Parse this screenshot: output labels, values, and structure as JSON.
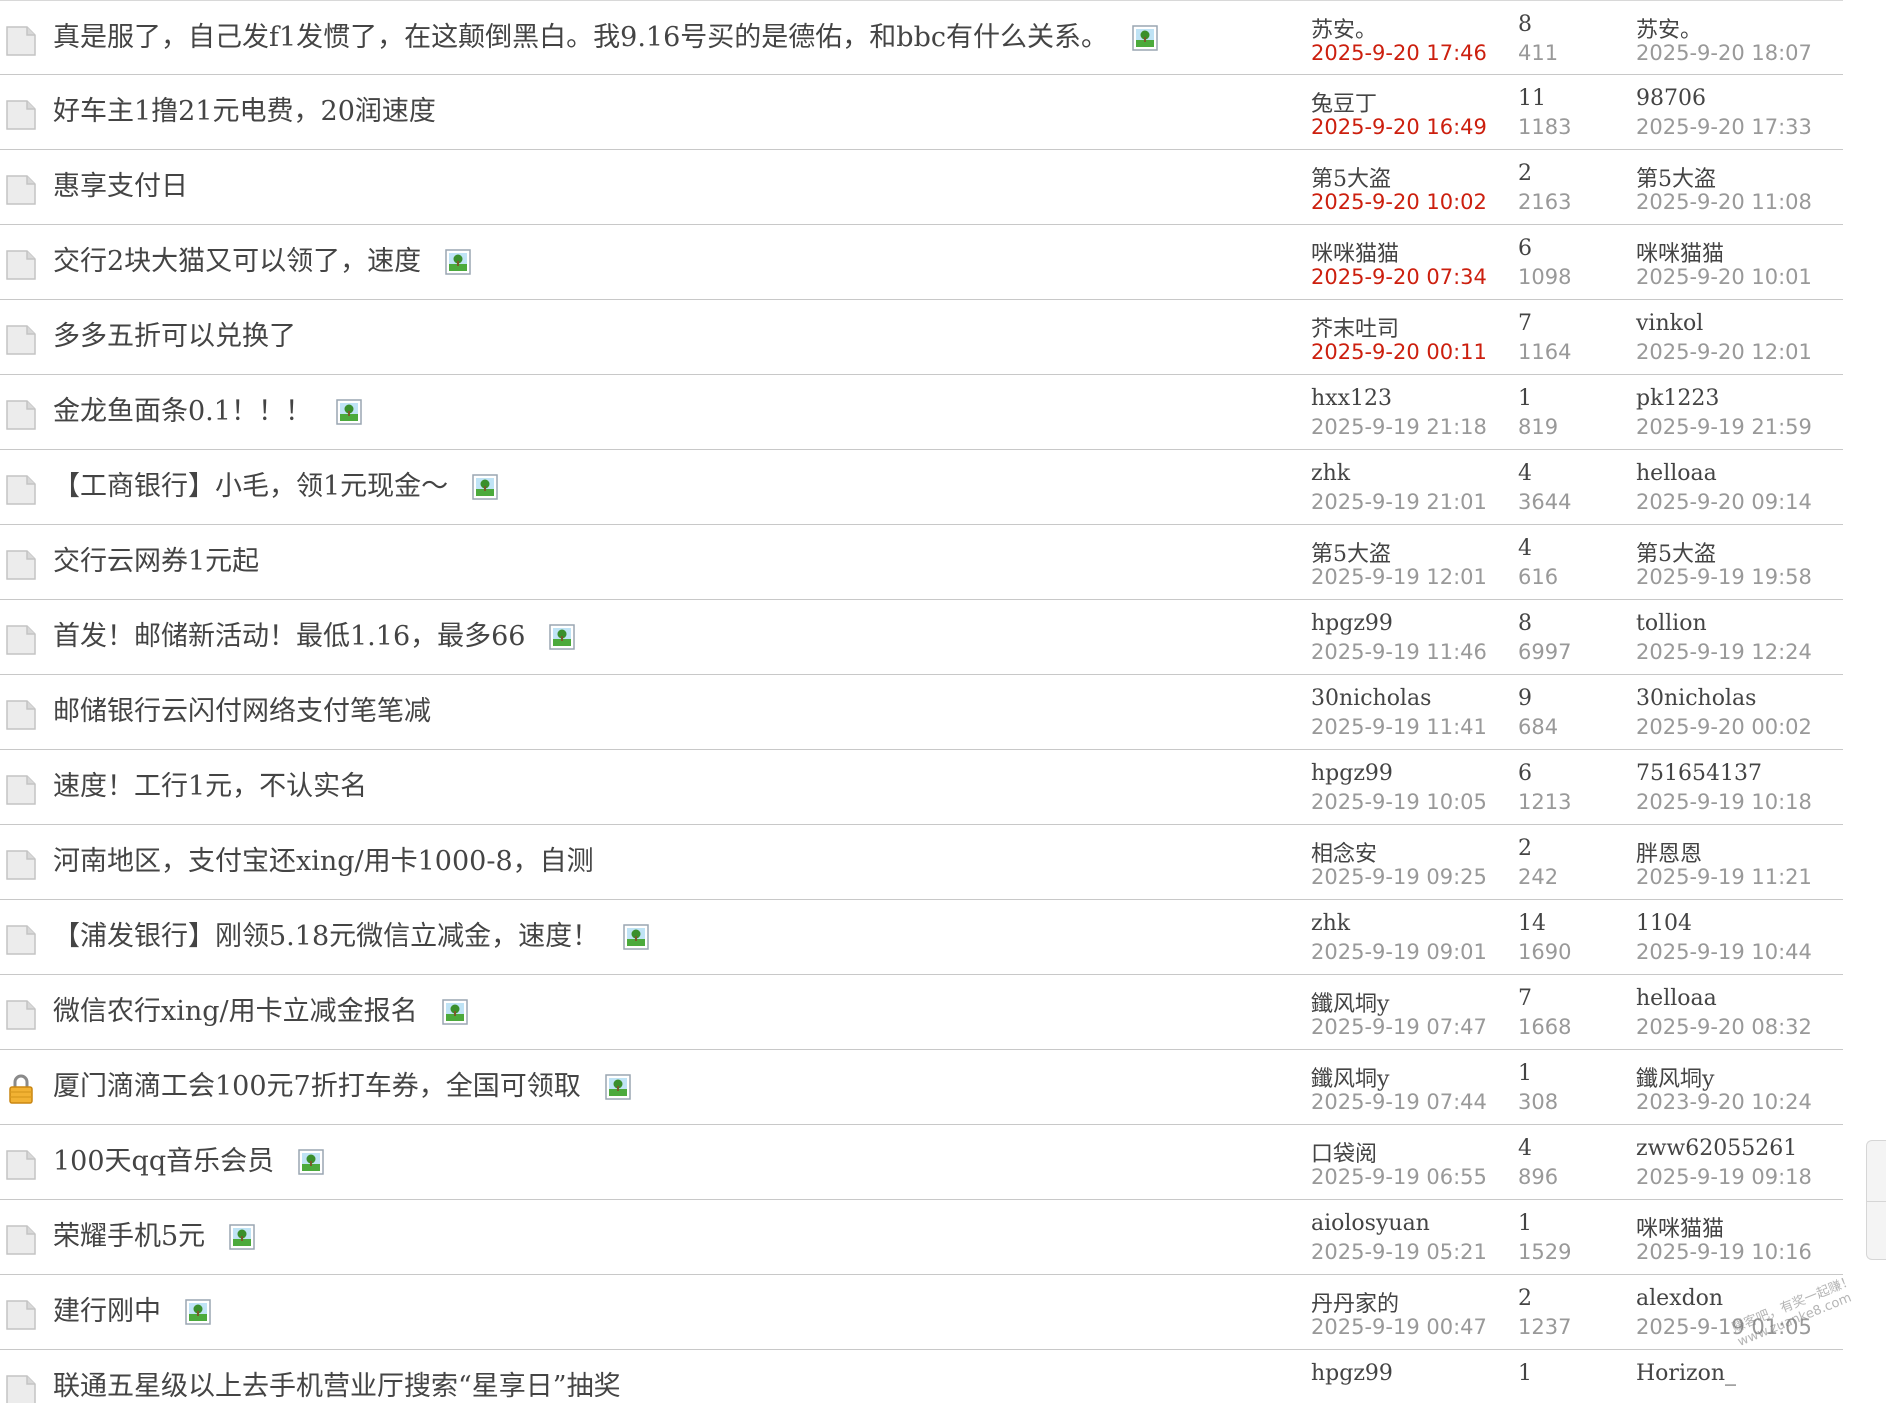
{
  "colors": {
    "new_time": "#cc1f0e",
    "muted": "#999999",
    "text": "#444444",
    "divider": "#c8c8c8"
  },
  "threads": [
    {
      "subject": "真是服了，自己发f1发惯了，在这颠倒黑白。我9.16号买的是德佑，和bbc有什么关系。",
      "icon": "folder-icon",
      "has_image": true,
      "author": "苏安。",
      "post_time": "2025-9-20 17:46",
      "post_time_new": true,
      "replies": "8",
      "views": "411",
      "last_user": "苏安。",
      "last_time": "2025-9-20 18:07"
    },
    {
      "subject": "好车主1撸21元电费，20润速度",
      "icon": "folder-icon",
      "has_image": false,
      "author": "兔豆丁",
      "post_time": "2025-9-20 16:49",
      "post_time_new": true,
      "replies": "11",
      "views": "1183",
      "last_user": "98706",
      "last_time": "2025-9-20 17:33"
    },
    {
      "subject": "惠享支付日",
      "icon": "folder-icon",
      "has_image": false,
      "author": "第5大盗",
      "post_time": "2025-9-20 10:02",
      "post_time_new": true,
      "replies": "2",
      "views": "2163",
      "last_user": "第5大盗",
      "last_time": "2025-9-20 11:08"
    },
    {
      "subject": "交行2块大猫又可以领了，速度",
      "icon": "folder-icon",
      "has_image": true,
      "author": "咪咪猫猫",
      "post_time": "2025-9-20 07:34",
      "post_time_new": true,
      "replies": "6",
      "views": "1098",
      "last_user": "咪咪猫猫",
      "last_time": "2025-9-20 10:01"
    },
    {
      "subject": "多多五折可以兑换了",
      "icon": "folder-icon",
      "has_image": false,
      "author": "芥末吐司",
      "post_time": "2025-9-20 00:11",
      "post_time_new": true,
      "replies": "7",
      "views": "1164",
      "last_user": "vinkol",
      "last_time": "2025-9-20 12:01"
    },
    {
      "subject": "金龙鱼面条0.1！！！",
      "icon": "folder-icon",
      "has_image": true,
      "author": "hxx123",
      "post_time": "2025-9-19 21:18",
      "post_time_new": false,
      "replies": "1",
      "views": "819",
      "last_user": "pk1223",
      "last_time": "2025-9-19 21:59"
    },
    {
      "subject": "【工商银行】小毛，领1元现金～",
      "icon": "folder-icon",
      "has_image": true,
      "author": "zhk",
      "post_time": "2025-9-19 21:01",
      "post_time_new": false,
      "replies": "4",
      "views": "3644",
      "last_user": "helloaa",
      "last_time": "2025-9-20 09:14"
    },
    {
      "subject": "交行云网券1元起",
      "icon": "folder-icon",
      "has_image": false,
      "author": "第5大盗",
      "post_time": "2025-9-19 12:01",
      "post_time_new": false,
      "replies": "4",
      "views": "616",
      "last_user": "第5大盗",
      "last_time": "2025-9-19 19:58"
    },
    {
      "subject": "首发！邮储新活动！最低1.16，最多66",
      "icon": "folder-icon",
      "has_image": true,
      "author": "hpgz99",
      "post_time": "2025-9-19 11:46",
      "post_time_new": false,
      "replies": "8",
      "views": "6997",
      "last_user": "tollion",
      "last_time": "2025-9-19 12:24"
    },
    {
      "subject": "邮储银行云闪付网络支付笔笔减",
      "icon": "folder-icon",
      "has_image": false,
      "author": "30nicholas",
      "post_time": "2025-9-19 11:41",
      "post_time_new": false,
      "replies": "9",
      "views": "684",
      "last_user": "30nicholas",
      "last_time": "2025-9-20 00:02"
    },
    {
      "subject": "速度！工行1元，不认实名",
      "icon": "folder-icon",
      "has_image": false,
      "author": "hpgz99",
      "post_time": "2025-9-19 10:05",
      "post_time_new": false,
      "replies": "6",
      "views": "1213",
      "last_user": "751654137",
      "last_time": "2025-9-19 10:18"
    },
    {
      "subject": "河南地区，支付宝还xing/用卡1000-8，自测",
      "icon": "folder-icon",
      "has_image": false,
      "author": "相念安",
      "post_time": "2025-9-19 09:25",
      "post_time_new": false,
      "replies": "2",
      "views": "242",
      "last_user": "胖恩恩",
      "last_time": "2025-9-19 11:21"
    },
    {
      "subject": "【浦发银行】刚领5.18元微信立减金，速度！",
      "icon": "folder-icon",
      "has_image": true,
      "author": "zhk",
      "post_time": "2025-9-19 09:01",
      "post_time_new": false,
      "replies": "14",
      "views": "1690",
      "last_user": "1104",
      "last_time": "2025-9-19 10:44"
    },
    {
      "subject": "微信农行xing/用卡立减金报名",
      "icon": "folder-icon",
      "has_image": true,
      "author": "鑯风垌y",
      "post_time": "2025-9-19 07:47",
      "post_time_new": false,
      "replies": "7",
      "views": "1668",
      "last_user": "helloaa",
      "last_time": "2025-9-20 08:32"
    },
    {
      "subject": "厦门滴滴工会100元7折打车券，全国可领取",
      "icon": "lock-icon",
      "has_image": true,
      "author": "鑯风垌y",
      "post_time": "2025-9-19 07:44",
      "post_time_new": false,
      "replies": "1",
      "views": "308",
      "last_user": "鑯风垌y",
      "last_time": "2023-9-20 10:24"
    },
    {
      "subject": "100天qq音乐会员",
      "icon": "folder-icon",
      "has_image": true,
      "author": "口袋阅",
      "post_time": "2025-9-19 06:55",
      "post_time_new": false,
      "replies": "4",
      "views": "896",
      "last_user": "zww62055261",
      "last_time": "2025-9-19 09:18"
    },
    {
      "subject": "荣耀手机5元",
      "icon": "folder-icon",
      "has_image": true,
      "author": "aiolosyuan",
      "post_time": "2025-9-19 05:21",
      "post_time_new": false,
      "replies": "1",
      "views": "1529",
      "last_user": "咪咪猫猫",
      "last_time": "2025-9-19 10:16"
    },
    {
      "subject": "建行刚中",
      "icon": "folder-icon",
      "has_image": true,
      "author": "丹丹家的",
      "post_time": "2025-9-19 00:47",
      "post_time_new": false,
      "replies": "2",
      "views": "1237",
      "last_user": "alexdon",
      "last_time": "2025-9-19 01:05"
    },
    {
      "subject": "联通五星级以上去手机营业厅搜索“星享日”抽奖",
      "icon": "folder-icon",
      "has_image": false,
      "author": "hpgz99",
      "post_time": "",
      "post_time_new": false,
      "replies": "1",
      "views": "",
      "last_user": "Horizon_",
      "last_time": ""
    }
  ],
  "watermark": {
    "line1": "赚客吧，有奖一起赚！",
    "line2": "www.zuanke8.com"
  }
}
